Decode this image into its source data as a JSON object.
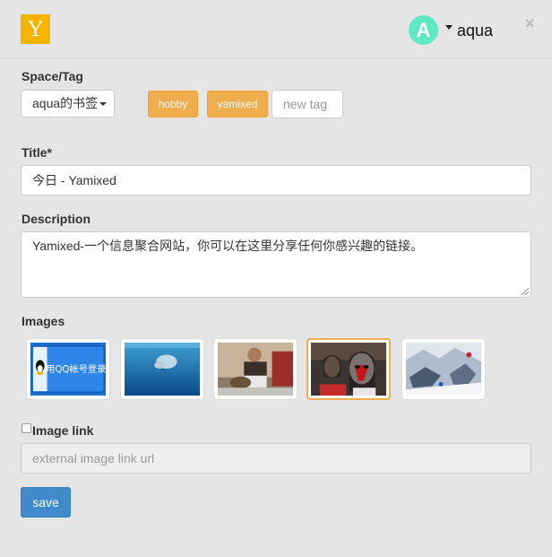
{
  "header": {
    "logo_letter": "Y",
    "avatar_letter": "A",
    "username": "aqua",
    "close_symbol": "×"
  },
  "space": {
    "label": "Space/Tag",
    "selected": "aqua的书签",
    "tags": [
      "hobby",
      "yamixed"
    ],
    "new_tag_placeholder": "new tag"
  },
  "title_field": {
    "label": "Title*",
    "value": "今日 - Yamixed"
  },
  "description_field": {
    "label": "Description",
    "value": "Yamixed-一个信息聚合网站，你可以在这里分享任何你感兴趣的链接。"
  },
  "images": {
    "label": "Images",
    "qq_button_text": "用QQ帐号登录",
    "thumbnails": [
      "qq-login",
      "underwater-swimmer",
      "man-with-dog",
      "face-paint-girls",
      "snowy-rocks"
    ],
    "selected_index": 3
  },
  "image_link": {
    "label": "Image link",
    "placeholder": "external image link url"
  },
  "save_label": "save",
  "colors": {
    "logo": "#f5b400",
    "avatar": "#5ee8c4",
    "tag": "#f0ad4e",
    "save": "#428bca",
    "selected_border": "#f0ad4e"
  }
}
